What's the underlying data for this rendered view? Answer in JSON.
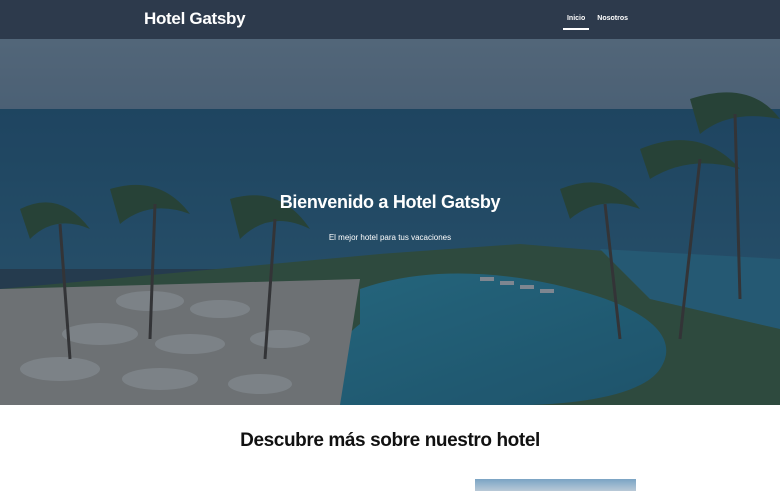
{
  "header": {
    "brand": "Hotel Gatsby",
    "nav": [
      {
        "label": "Inicio",
        "active": true
      },
      {
        "label": "Nosotros",
        "active": false
      }
    ]
  },
  "hero": {
    "title": "Bienvenido a Hotel Gatsby",
    "subtitle": "El mejor hotel para tus vacaciones"
  },
  "section": {
    "title": "Descubre más sobre nuestro hotel"
  },
  "colors": {
    "header_bg": "#2d3a4c",
    "overlay": "rgba(32,48,66,0.55)"
  }
}
